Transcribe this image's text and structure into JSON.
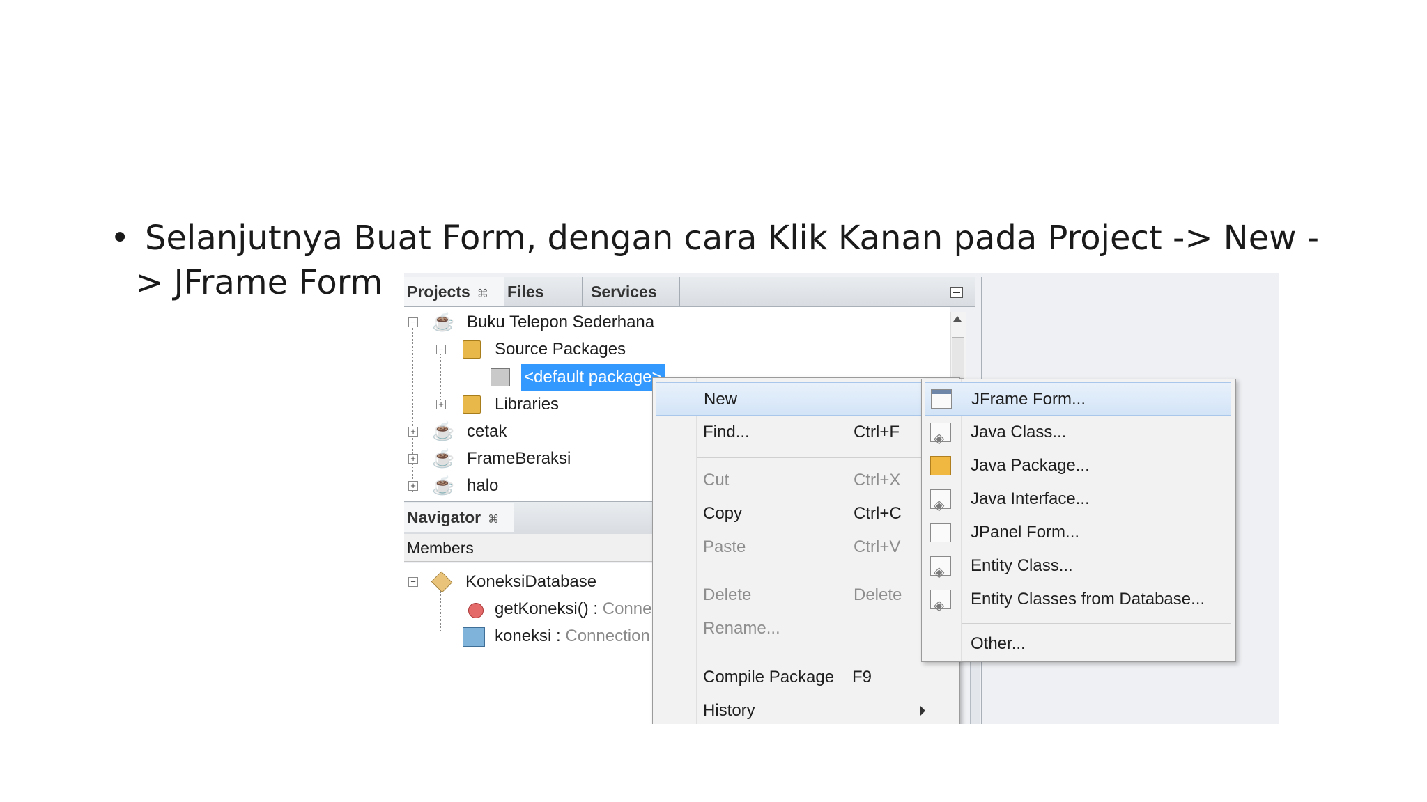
{
  "slide": {
    "bullet": "•",
    "line1": "Selanjutnya Buat Form, dengan cara Klik Kanan pada Project -> New -",
    "line2": "> JFrame Form"
  },
  "tabs": [
    {
      "label": "Projects",
      "close": "⌘"
    },
    {
      "label": "Files"
    },
    {
      "label": "Services"
    }
  ],
  "tree": {
    "project": "Buku Telepon Sederhana",
    "source_packages": "Source Packages",
    "default_package": "<default package>",
    "libraries": "Libraries",
    "other_projects": [
      "cetak",
      "FrameBeraksi",
      "halo"
    ]
  },
  "navigator": {
    "title": "Navigator",
    "close": "⌘",
    "members_label": "Members",
    "class_name": "KoneksiDatabase",
    "method_name": "getKoneksi() : ",
    "method_type": "Connec",
    "field_name": "koneksi : ",
    "field_type": "Connection"
  },
  "context_menu": {
    "items": [
      {
        "label": "New",
        "submenu": true
      },
      {
        "label": "Find...",
        "shortcut": "Ctrl+F"
      },
      {
        "label": "Cut",
        "shortcut": "Ctrl+X",
        "disabled": true
      },
      {
        "label": "Copy",
        "shortcut": "Ctrl+C"
      },
      {
        "label": "Paste",
        "shortcut": "Ctrl+V",
        "disabled": true
      },
      {
        "label": "Delete",
        "shortcut": "Delete",
        "disabled": true
      },
      {
        "label": "Rename...",
        "disabled": true
      },
      {
        "label": "Compile Package",
        "shortcut": "F9"
      },
      {
        "label": "History",
        "submenu": true
      }
    ]
  },
  "new_submenu": {
    "items": [
      {
        "label": "JFrame Form...",
        "icon": "jframe-icon"
      },
      {
        "label": "Java Class...",
        "icon": "java-class-icon"
      },
      {
        "label": "Java Package...",
        "icon": "java-package-icon"
      },
      {
        "label": "Java Interface...",
        "icon": "java-interface-icon"
      },
      {
        "label": "JPanel Form...",
        "icon": "jpanel-icon"
      },
      {
        "label": "Entity Class...",
        "icon": "entity-class-icon"
      },
      {
        "label": "Entity Classes from Database...",
        "icon": "entity-db-icon"
      },
      {
        "label": "Other..."
      }
    ]
  },
  "colors": {
    "selection": "#3399ff",
    "menu_highlight": "#d3e4f7"
  }
}
